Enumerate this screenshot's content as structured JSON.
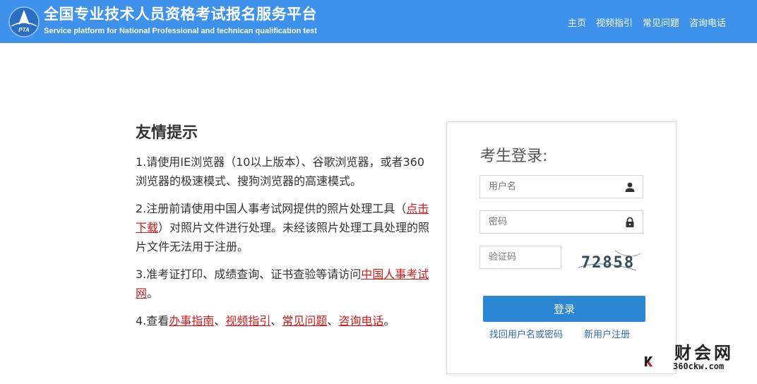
{
  "header": {
    "title_cn": "全国专业技术人员资格考试报名服务平台",
    "title_en": "Service platform for National Professional and technican qualification test",
    "logo_text": "PTA",
    "nav": [
      "主页",
      "视频指引",
      "常见问题",
      "咨询电话"
    ]
  },
  "tips": {
    "title": "友情提示",
    "t1": "1.请使用IE浏览器（10以上版本）、谷歌浏览器，或者360浏览器的极速模式、搜狗浏览器的高速模式。",
    "t2_a": "2.注册前请使用中国人事考试网提供的照片处理工具（",
    "t2_link": "点击下载",
    "t2_b": "）对照片文件进行处理。未经该照片处理工具处理的照片文件无法用于注册。",
    "t3_a": "3.准考证打印、成绩查询、证书查验等请访问",
    "t3_link": "中国人事考试网",
    "t3_b": "。",
    "t4_a": "4.查看",
    "t4_links": [
      "办事指南",
      "视频指引",
      "常见问题",
      "咨询电话"
    ],
    "t4_sep": "、",
    "t4_end": "。"
  },
  "login": {
    "title": "考生登录:",
    "username_placeholder": "用户名",
    "password_placeholder": "密码",
    "captcha_placeholder": "验证码",
    "captcha_text": "72858",
    "submit": "登录",
    "recover": "找回用户名或密码",
    "register": "新用户注册"
  },
  "watermark": {
    "text": "财会网",
    "url": "360ckw.com"
  }
}
